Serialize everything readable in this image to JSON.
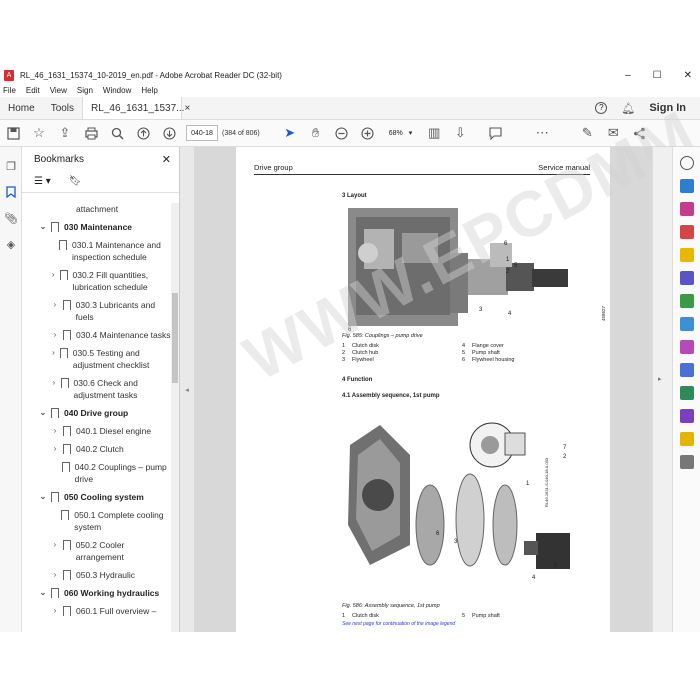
{
  "window": {
    "title": "RL_46_1631_15374_10-2019_en.pdf - Adobe Acrobat Reader DC (32-bit)",
    "minimize": "–",
    "maximize": "☐",
    "close": "✕"
  },
  "menu": [
    "File",
    "Edit",
    "View",
    "Sign",
    "Window",
    "Help"
  ],
  "tabs": {
    "home": "Home",
    "tools": "Tools",
    "doc": "RL_46_1631_1537...",
    "doc_close": "×",
    "signin": "Sign In"
  },
  "toolbar": {
    "page_input": "040-18",
    "page_of": "(384 of 806)",
    "zoom": "68%"
  },
  "bookmarks": {
    "title": "Bookmarks",
    "items": [
      {
        "level": 2,
        "label": "attachment",
        "chev": ""
      },
      {
        "level": 1,
        "label": "030 Maintenance",
        "chev": "⌄"
      },
      {
        "level": 2,
        "label": "030.1 Maintenance and inspection schedule",
        "chev": ""
      },
      {
        "level": 2,
        "label": "030.2 Fill quantities, lubrication schedule",
        "chev": "›"
      },
      {
        "level": 2,
        "label": "030.3 Lubricants and fuels",
        "chev": "›"
      },
      {
        "level": 2,
        "label": "030.4 Maintenance tasks",
        "chev": "›"
      },
      {
        "level": 2,
        "label": "030.5 Testing and adjustment checklist",
        "chev": "›"
      },
      {
        "level": 2,
        "label": "030.6 Check and adjustment tasks",
        "chev": "›"
      },
      {
        "level": 1,
        "label": "040 Drive group",
        "chev": "⌄"
      },
      {
        "level": 2,
        "label": "040.1 Diesel engine",
        "chev": "›"
      },
      {
        "level": 2,
        "label": "040.2 Clutch",
        "chev": "›"
      },
      {
        "level": 2,
        "label": "040.2 Couplings – pump drive",
        "chev": ""
      },
      {
        "level": 1,
        "label": "050 Cooling system",
        "chev": "⌄"
      },
      {
        "level": 2,
        "label": "050.1 Complete cooling system",
        "chev": ""
      },
      {
        "level": 2,
        "label": "050.2 Cooler arrangement",
        "chev": "›"
      },
      {
        "level": 2,
        "label": "050.3 Hydraulic",
        "chev": "›"
      },
      {
        "level": 1,
        "label": "060 Working hydraulics",
        "chev": "⌄"
      },
      {
        "level": 2,
        "label": "060.1 Full overview –",
        "chev": "›"
      }
    ]
  },
  "page": {
    "header_left": "Drive group",
    "header_right": "Service manual",
    "sec_layout": "3 Layout",
    "fig1_caption": "Fig. 585: Couplings – pump drive",
    "fig1_id": "458627",
    "legend1": [
      [
        "1",
        "Clutch disk",
        "4",
        "Flange cover"
      ],
      [
        "2",
        "Clutch hub",
        "5",
        "Pump shaft"
      ],
      [
        "3",
        "Flywheel",
        "6",
        "Flywheel housing"
      ]
    ],
    "sec_function": "4 Function",
    "sec_assembly": "4.1 Assembly sequence, 1st pump",
    "fig2_caption": "Fig. 586: Assembly sequence, 1st pump",
    "fig2_id": "RL46-1631-S-040-18-0-003",
    "legend2": [
      [
        "1",
        "Clutch disk",
        "5",
        "Pump shaft"
      ]
    ],
    "note": "See next page for continuation of the image legend",
    "callouts1": [
      "6",
      "1",
      "2",
      "5",
      "3",
      "4"
    ],
    "callouts2": [
      "7",
      "2",
      "1",
      "3",
      "6",
      "5",
      "4"
    ]
  },
  "watermark": "WWW.EPCDMM.COM"
}
